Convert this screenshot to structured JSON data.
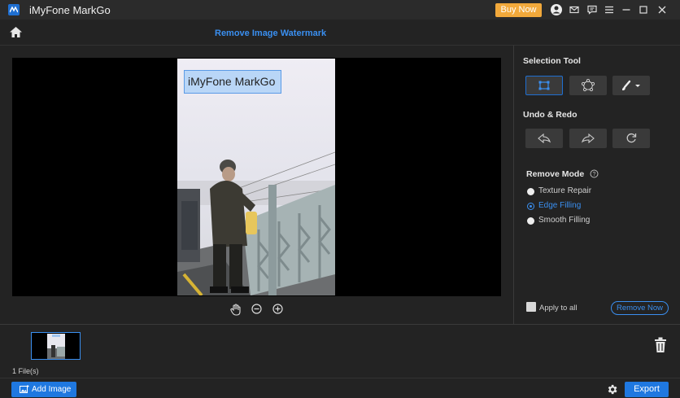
{
  "app": {
    "title": "iMyFone MarkGo",
    "buy_label": "Buy Now"
  },
  "header": {
    "title": "Remove Image Watermark"
  },
  "canvas": {
    "watermark_text": "iMyFone MarkGo"
  },
  "panel": {
    "selection_title": "Selection Tool",
    "undo_title": "Undo & Redo",
    "remove_mode_title": "Remove Mode",
    "modes": [
      {
        "label": "Texture Repair",
        "selected": false
      },
      {
        "label": "Edge Filling",
        "selected": true
      },
      {
        "label": "Smooth Filling",
        "selected": false
      }
    ],
    "apply_all_label": "Apply to all",
    "remove_now_label": "Remove Now"
  },
  "footer": {
    "files_count": "1 File(s)",
    "add_image_label": "Add Image",
    "export_label": "Export"
  },
  "colors": {
    "accent": "#3a8ff0",
    "buy": "#f2a93b",
    "primary_button": "#1f78e0"
  }
}
